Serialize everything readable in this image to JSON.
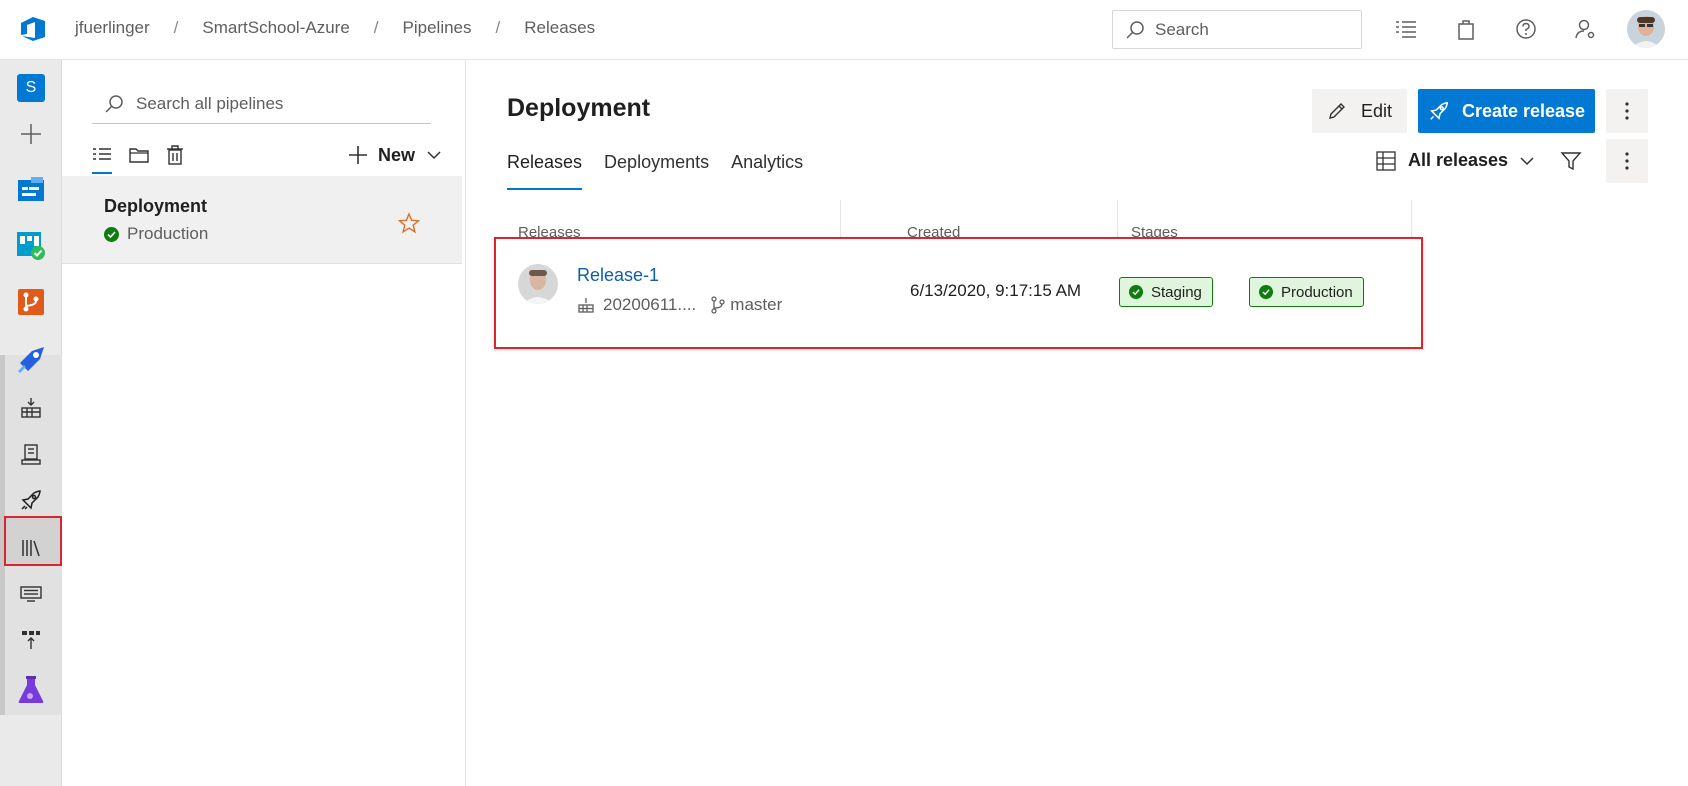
{
  "breadcrumb": [
    "jfuerlinger",
    "SmartSchool-Azure",
    "Pipelines",
    "Releases"
  ],
  "search": {
    "placeholder": "Search"
  },
  "top_icons": [
    "list-icon",
    "shopping-bag-icon",
    "help-icon",
    "user-settings-icon"
  ],
  "nav": {
    "project_initial": "S",
    "items": [
      "add-icon",
      "boards-icon",
      "test-plans-icon",
      "repos-icon",
      "pipelines-icon",
      "builds-icon",
      "environments-icon",
      "releases-icon",
      "library-icon",
      "task-groups-icon",
      "deployment-groups-icon",
      "test-lab-icon"
    ],
    "selected": "releases-icon"
  },
  "pipelines_panel": {
    "search_placeholder": "Search all pipelines",
    "new_label": "New",
    "items": [
      {
        "name": "Deployment",
        "environment": "Production",
        "status": "succeeded"
      }
    ]
  },
  "main": {
    "title": "Deployment",
    "edit_label": "Edit",
    "create_label": "Create release",
    "tabs": [
      "Releases",
      "Deployments",
      "Analytics"
    ],
    "active_tab": "Releases",
    "view_label": "All releases",
    "columns": [
      "Releases",
      "Created",
      "Stages"
    ],
    "rows": [
      {
        "name": "Release-1",
        "build": "20200611....",
        "branch": "master",
        "created": "6/13/2020, 9:17:15 AM",
        "stages": [
          "Staging",
          "Production"
        ]
      }
    ]
  },
  "colors": {
    "accent": "#0078d4",
    "success": "#107c10",
    "highlight": "#d7262d"
  }
}
